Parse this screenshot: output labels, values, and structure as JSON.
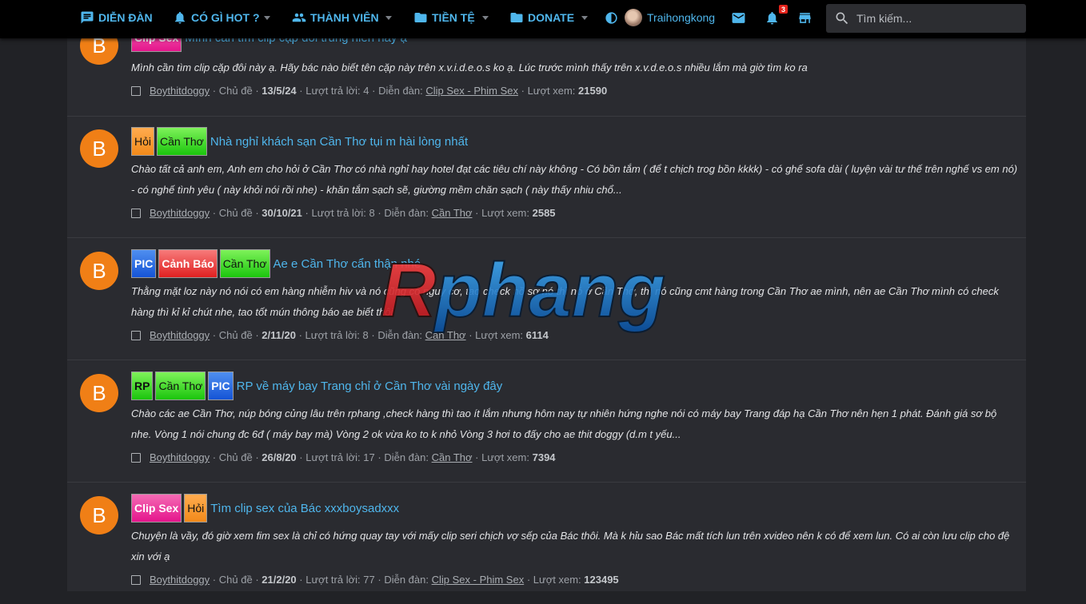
{
  "nav": {
    "forum": "DIỄN ĐÀN",
    "hot": "CÓ GÌ HOT ?",
    "members": "THÀNH VIÊN",
    "money": "TIỀN TỆ",
    "donate": "DONATE",
    "username": "Traihongkong",
    "notif_count": "3",
    "search_placeholder": "Tìm kiếm..."
  },
  "watermark": "Rphang",
  "labels": {
    "thread_type": "Chủ đề",
    "replies": "Lượt trả lời:",
    "forum": "Diễn đàn:",
    "views": "Lượt xem:",
    "sep": "·"
  },
  "threads": [
    {
      "avatar": "B",
      "tags": [
        "Clip Sex"
      ],
      "title": "Mình cần tìm clip cặp đôi trung niên này ạ",
      "snippet": "Mình cần tìm clip cặp đôi này ạ. Hãy bác nào biết tên cặp này trên x.v.i.d.e.o.s ko ạ. Lúc trước mình thấy trên x.v.d.e.o.s nhiều lắm mà giờ tìm ko ra",
      "author": "Boythitdoggy",
      "date": "13/5/24",
      "replies": "4",
      "forum": "Clip Sex - Phim Sex",
      "views": "21590"
    },
    {
      "avatar": "B",
      "tags": [
        "Hỏi",
        "Cần Thơ"
      ],
      "title": "Nhà nghỉ khách sạn Cần Thơ tụi m hài lòng nhất",
      "snippet": "Chào tất cả anh em, Anh em cho hỏi ở Cần Thơ có nhà nghỉ hay hotel đạt các tiêu chí này không - Có bồn tắm ( để t chịch trog bồn kkkk) - có ghế sofa dài ( luyện vài tư thế trên nghế vs em nó) - có nghế tình yêu ( này khỏi nói rồi nhe) - khăn tắm sạch sẽ, giường mềm chăn sạch ( này thấy nhiu chổ...",
      "author": "Boythitdoggy",
      "date": "30/10/21",
      "replies": "8",
      "forum": "Cần Thơ",
      "views": "2585"
    },
    {
      "avatar": "B",
      "tags": [
        "PIC",
        "Cảnh Báo",
        "Cần Thơ"
      ],
      "title": "Ae e Cần Thơ cẩn thận nhé",
      "snippet": "Thằng mặt loz này nó nói có em hàng nhiễm hiv và nó cũng có nguy cơ, tao check hồ sơ nó thì nó ở Cần Thơ, thì nó cũng cmt hàng trong Cần Thơ ae mình, nên ae Cần Thơ mình có check hàng thì kỉ kỉ chút nhe, tao tốt mún thông báo ae biết thôi",
      "author": "Boythitdoggy",
      "date": "2/11/20",
      "replies": "8",
      "forum": "Cần Thơ",
      "views": "6114"
    },
    {
      "avatar": "B",
      "tags": [
        "RP",
        "Cần Thơ",
        "PIC"
      ],
      "title": "RP về máy bay Trang chỉ ở Cần Thơ vài ngày đây",
      "snippet": "Chào các ae Cần Thơ, núp bóng củng lâu trên rphang ,check hàng thì tao ít lắm nhưng hôm nay tự nhiên hứng nghe nói có máy bay Trang đáp hạ Cần Thơ nên hẹn 1 phát. Đánh giá sơ bộ nhe. Vòng 1 nói chung đc 6đ ( máy bay mà) Vòng 2 ok vừa ko to k nhỏ Vòng 3 hơi to đấy cho ae thit doggy (d.m t yếu...",
      "author": "Boythitdoggy",
      "date": "26/8/20",
      "replies": "17",
      "forum": "Cần Thơ",
      "views": "7394"
    },
    {
      "avatar": "B",
      "tags": [
        "Clip Sex",
        "Hỏi"
      ],
      "title": "Tìm clip sex của Bác xxxboysadxxx",
      "snippet": "Chuyện là vầy, đó giờ xem fim sex là chỉ có hứng quay tay với mấy clip seri chịch vợ sếp của Bác thôi. Mà k hỉu sao Bác mất tích lun trên xvideo nên k có để xem lun. Có ai còn lưu clip cho đệ xin với ạ",
      "author": "Boythitdoggy",
      "date": "21/2/20",
      "replies": "77",
      "forum": "Clip Sex - Phim Sex",
      "views": "123495"
    }
  ],
  "colors": {
    "accent": "#4fb6ec",
    "avatar": "#f07f16",
    "badge": "#e5231b"
  }
}
